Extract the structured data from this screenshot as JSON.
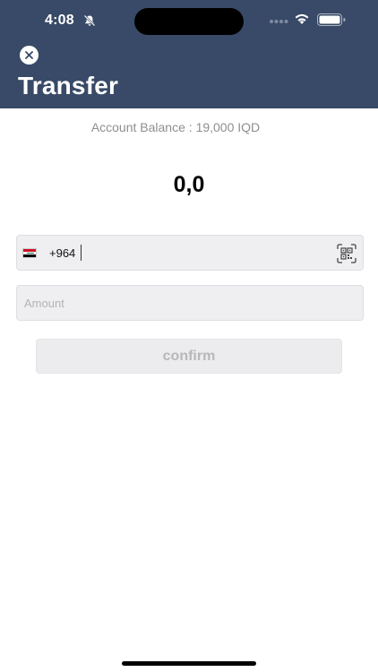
{
  "status_bar": {
    "time": "4:08",
    "icons": [
      "bell-slash-icon",
      "signal-icon",
      "wifi-icon",
      "battery-icon"
    ]
  },
  "header": {
    "title": "Transfer",
    "close_icon": "close-icon",
    "background": "#384a67"
  },
  "balance": {
    "label": "Account Balance :",
    "value": "19,000 IQD"
  },
  "amount_display": "0,0",
  "phone_input": {
    "country_flag": "iraq-flag-icon",
    "prefix": "+964",
    "scan_icon": "qr-scan-icon"
  },
  "amount_input": {
    "value": "",
    "placeholder": "Amount"
  },
  "confirm_button": {
    "label": "confirm"
  }
}
